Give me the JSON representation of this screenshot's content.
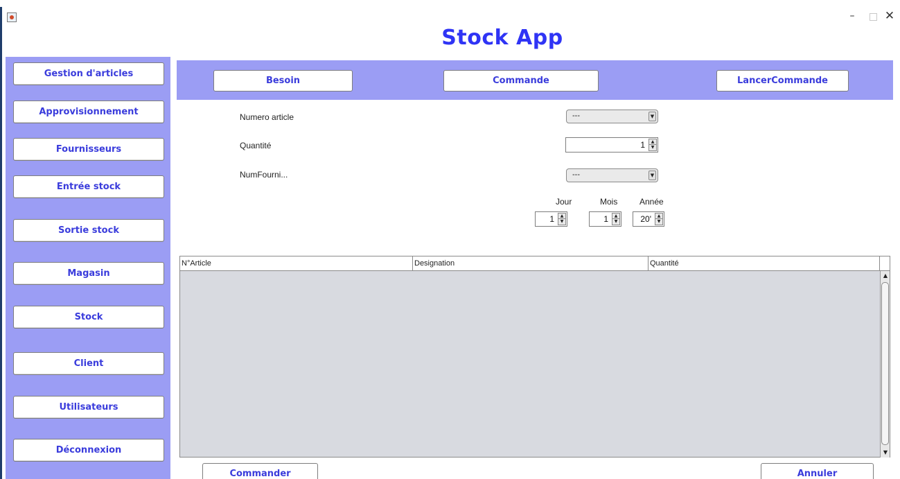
{
  "window": {
    "title": "Stock App",
    "controls": {
      "minimize": "–",
      "maximize": "",
      "close": "✕"
    }
  },
  "sidebar": {
    "items": [
      {
        "label": "Gestion d'articles"
      },
      {
        "label": "Approvisionnement"
      },
      {
        "label": "Fournisseurs"
      },
      {
        "label": "Entrée stock"
      },
      {
        "label": "Sortie stock"
      },
      {
        "label": "Magasin"
      },
      {
        "label": "Stock"
      },
      {
        "label": "Client"
      },
      {
        "label": "Utilisateurs"
      },
      {
        "label": "Déconnexion"
      }
    ]
  },
  "tabs": {
    "besoin": "Besoin",
    "commande": "Commande",
    "lancer": "LancerCommande"
  },
  "form": {
    "numero_article": {
      "label": "Numero article",
      "value": "---"
    },
    "quantite": {
      "label": "Quantité",
      "value": "1"
    },
    "num_fourni": {
      "label": "NumFourni...",
      "value": "---"
    },
    "date": {
      "jour": {
        "label": "Jour",
        "value": "1"
      },
      "mois": {
        "label": "Mois",
        "value": "1"
      },
      "annee": {
        "label": "Année",
        "value": "20'"
      }
    }
  },
  "table": {
    "columns": [
      "N°Article",
      "Designation",
      "Quantité"
    ],
    "rows": []
  },
  "actions": {
    "commander": "Commander",
    "annuler": "Annuler"
  },
  "colors": {
    "title": "#2f34f5",
    "panel": "#9b9df4",
    "button_text": "#3a3cdc",
    "table_bg": "#d8dae0"
  },
  "icons": {
    "app": "java-cup-icon",
    "dropdown": "triangle-down-icon",
    "spinner": "up-down-arrow-icon"
  }
}
